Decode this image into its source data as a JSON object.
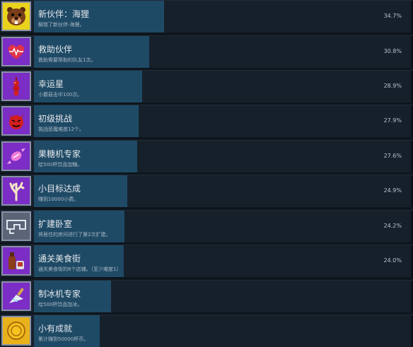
{
  "achievements": [
    {
      "title": "新伙伴：海狸",
      "desc": "解锁了新伙伴-海狸。",
      "percent": "34.7%",
      "fraction": 0.347,
      "icon": "beaver-icon",
      "icon_bg": "#e9d31d"
    },
    {
      "title": "救助伙伴",
      "desc": "救助需要帮助的队友1次。",
      "percent": "30.8%",
      "fraction": 0.308,
      "icon": "heart-icon",
      "icon_bg": "#7b2dc6"
    },
    {
      "title": "幸运星",
      "desc": "小蘑菇击中100次。",
      "percent": "28.9%",
      "fraction": 0.289,
      "icon": "lucky-star-icon",
      "icon_bg": "#7b2dc6"
    },
    {
      "title": "初级挑战",
      "desc": "挑战恶魔难度12个。",
      "percent": "27.9%",
      "fraction": 0.279,
      "icon": "devil-icon",
      "icon_bg": "#7b2dc6"
    },
    {
      "title": "果糖机专家",
      "desc": "给500杯饮品加糖。",
      "percent": "27.6%",
      "fraction": 0.276,
      "icon": "candy-icon",
      "icon_bg": "#7b2dc6"
    },
    {
      "title": "小目标达成",
      "desc": "赚到10000小费。",
      "percent": "24.9%",
      "fraction": 0.249,
      "icon": "coral-icon",
      "icon_bg": "#7b2dc6"
    },
    {
      "title": "扩建卧室",
      "desc": "将居住的房间进行了第2次扩建。",
      "percent": "24.2%",
      "fraction": 0.242,
      "icon": "room-expand-icon",
      "icon_bg": "#5c6577"
    },
    {
      "title": "通关美食街",
      "desc": "通关美食街的6个店铺。（至少难度1）",
      "percent": "24.0%",
      "fraction": 0.24,
      "icon": "food-street-icon",
      "icon_bg": "#7b2dc6"
    },
    {
      "title": "制冰机专家",
      "desc": "给500杯饮品加冰。",
      "percent": "",
      "fraction": 0.205,
      "icon": "ice-scoop-icon",
      "icon_bg": "#7b2dc6"
    },
    {
      "title": "小有成就",
      "desc": "累计赚到50000杯币。",
      "percent": "",
      "fraction": 0.175,
      "icon": "coin-icon",
      "icon_bg": "#e9b21d"
    }
  ]
}
